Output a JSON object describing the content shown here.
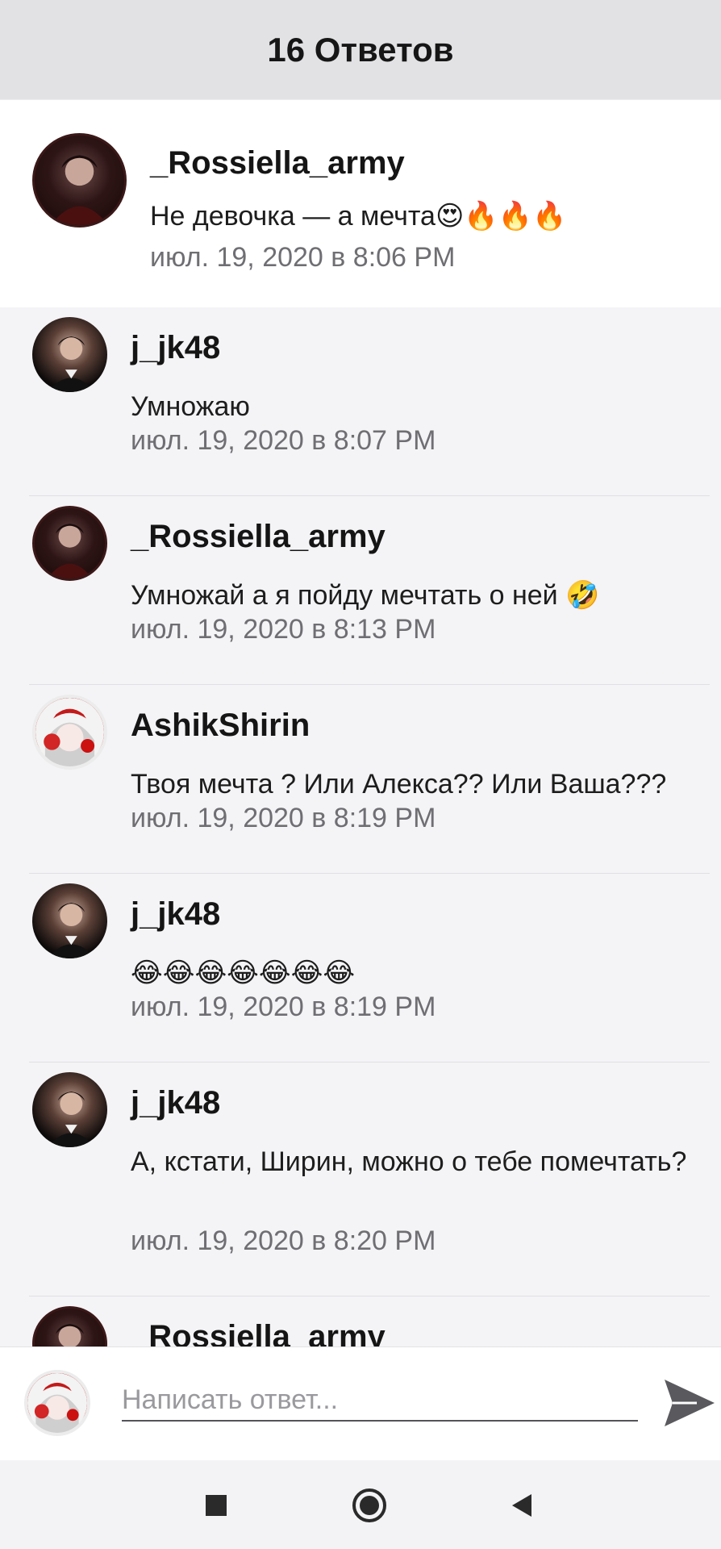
{
  "header": {
    "title": "16 Ответов"
  },
  "original_post": {
    "username": "_Rossiella_army",
    "message": "Не девочка — а мечта😍🔥🔥🔥",
    "timestamp": "июл. 19, 2020 в 8:06 PM",
    "avatar": "user-avatar-dark"
  },
  "replies": [
    {
      "username": "j_jk48",
      "message": "Умножаю",
      "timestamp": "июл. 19, 2020 в 8:07 PM",
      "avatar": "user-avatar-jk"
    },
    {
      "username": "_Rossiella_army",
      "message": "Умножай а я пойду мечтать о ней 🤣",
      "timestamp": "июл. 19, 2020 в 8:13 PM",
      "avatar": "user-avatar-dark"
    },
    {
      "username": "AshikShirin",
      "message": "Твоя мечта ? Или Алекса?? Или Ваша???",
      "timestamp": "июл. 19, 2020 в 8:19 PM",
      "avatar": "user-avatar-anime"
    },
    {
      "username": "j_jk48",
      "message": "😂😂😂😂😂😂😂",
      "timestamp": "июл. 19, 2020 в 8:19 PM",
      "avatar": "user-avatar-jk"
    },
    {
      "username": "j_jk48",
      "message": "А, кстати, Ширин, можно о тебе помечтать?",
      "timestamp": "июл. 19, 2020 в 8:20 PM",
      "avatar": "user-avatar-jk"
    },
    {
      "username": "_Rossiella_army",
      "message": "",
      "timestamp": "",
      "avatar": "user-avatar-dark"
    }
  ],
  "composer": {
    "placeholder": "Написать ответ...",
    "send_icon": "send-icon",
    "avatar": "user-avatar-anime"
  },
  "navbar": {
    "icons": [
      "recents-square-icon",
      "home-circle-icon",
      "back-triangle-icon"
    ]
  },
  "colors": {
    "header_bg": "#e2e1e4",
    "list_bg": "#f4f3f6",
    "timestamp": "#6f6f73"
  }
}
